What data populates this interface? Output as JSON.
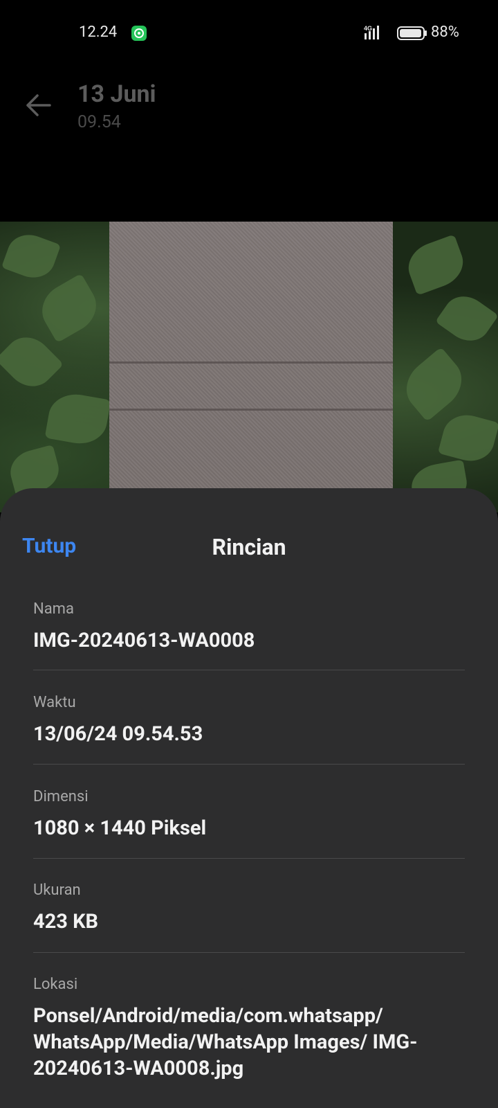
{
  "status_bar": {
    "time": "12.24",
    "network": "4G",
    "battery": "88%",
    "icons": [
      "whatsapp-notification-icon",
      "signal-4g-icon",
      "battery-icon"
    ]
  },
  "header": {
    "title": "13 Juni",
    "subtitle": "09.54",
    "back_icon": "arrow-left-icon"
  },
  "photo": {
    "description_icon": "photo-image"
  },
  "details": {
    "close_label": "Tutup",
    "title": "Rincian",
    "items": [
      {
        "label": "Nama",
        "value": "IMG-20240613-WA0008"
      },
      {
        "label": "Waktu",
        "value": "13/06/24 09.54.53"
      },
      {
        "label": "Dimensi",
        "value": "1080 × 1440 Piksel"
      },
      {
        "label": "Ukuran",
        "value": "423 KB"
      },
      {
        "label": "Lokasi",
        "value": "Ponsel/Android/media/com.whatsapp/ WhatsApp/Media/WhatsApp Images/ IMG-20240613-WA0008.jpg"
      }
    ]
  },
  "colors": {
    "accent": "#3d86f0",
    "sheet_bg": "#2d2d2e",
    "label": "#a8a8a8"
  }
}
